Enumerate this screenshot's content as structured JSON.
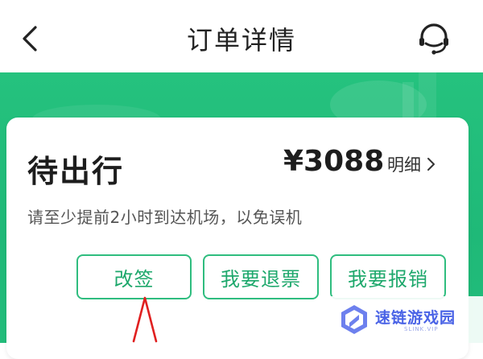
{
  "header": {
    "title": "订单详情",
    "back_icon": "chevron-left-icon",
    "service_icon": "customer-service-headset-icon"
  },
  "order": {
    "status": "待出行",
    "price": "¥3088",
    "detail_label": "明细",
    "hint": "请至少提前2小时到达机场，以免误机"
  },
  "actions": {
    "change": "改签",
    "refund": "我要退票",
    "reimburse": "我要报销"
  },
  "watermark": {
    "name": "速链游戏园",
    "sub": "SLINK.VIP"
  },
  "colors": {
    "accent": "#25c27e",
    "button_border": "#2fbd7f",
    "button_text": "#1ea86c",
    "annotation": "#e02020"
  }
}
